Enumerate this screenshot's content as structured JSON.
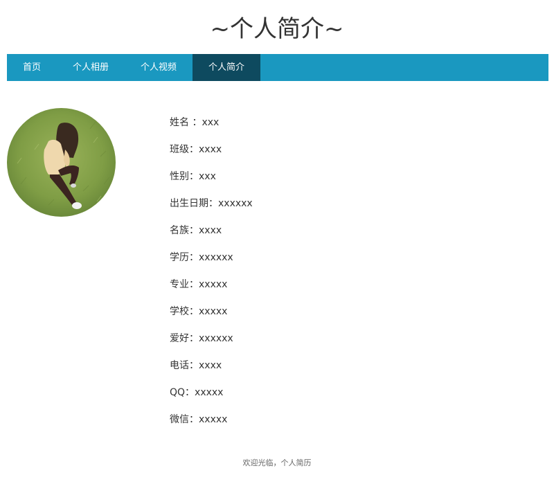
{
  "header": {
    "title": "~个人简介~"
  },
  "nav": {
    "items": [
      {
        "label": "首页"
      },
      {
        "label": "个人相册"
      },
      {
        "label": "个人视频"
      },
      {
        "label": "个人简介",
        "active": true
      }
    ],
    "color": "#1a98c0",
    "active_color": "#0e4a5f"
  },
  "profile": {
    "photo": "avatar-photo",
    "fields": [
      {
        "text": "姓名 ：xxx"
      },
      {
        "text": "班级：xxxx"
      },
      {
        "text": "性别：xxx"
      },
      {
        "text": "出生日期：xxxxxx"
      },
      {
        "text": "名族：xxxx"
      },
      {
        "text": "学历：xxxxxx"
      },
      {
        "text": "专业：xxxxx"
      },
      {
        "text": "学校：xxxxx"
      },
      {
        "text": "爱好：xxxxxx"
      },
      {
        "text": "电话：xxxx"
      },
      {
        "text": "QQ：xxxxx"
      },
      {
        "text": "微信：xxxxx"
      }
    ]
  },
  "footer": {
    "text": "欢迎光临，个人简历"
  }
}
